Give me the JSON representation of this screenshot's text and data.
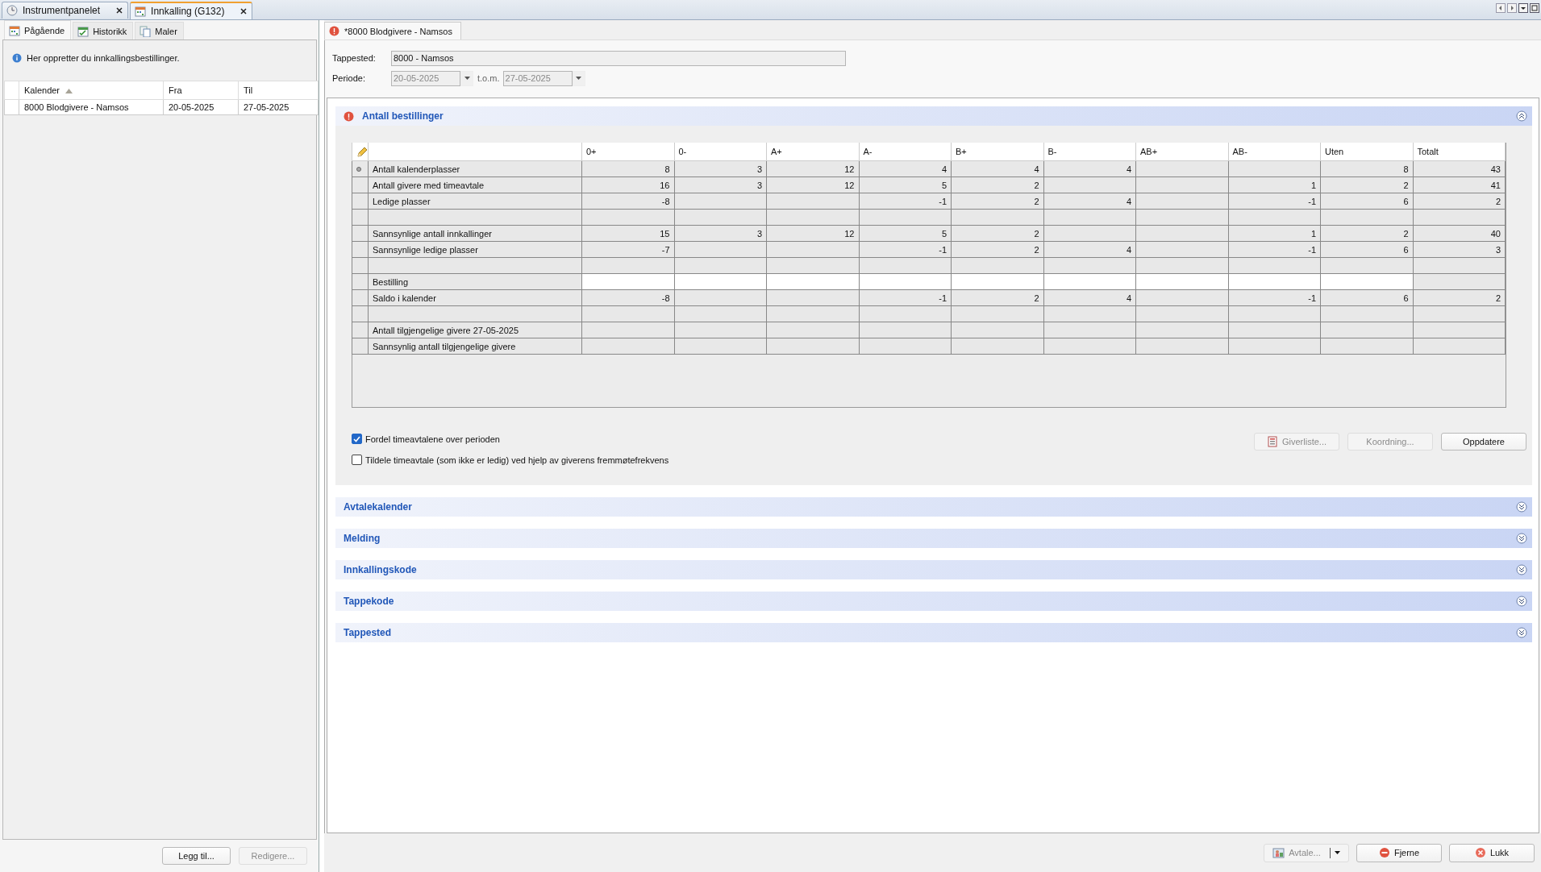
{
  "app_tabs": [
    {
      "label": "Instrumentpanelet",
      "selected": false
    },
    {
      "label": "Innkalling (G132)",
      "selected": true
    }
  ],
  "left_panel": {
    "tabs": [
      {
        "label": "Pågående",
        "selected": true
      },
      {
        "label": "Historikk",
        "selected": false
      },
      {
        "label": "Maler",
        "selected": false
      }
    ],
    "info": "Her oppretter du innkallingsbestillinger.",
    "table": {
      "columns": [
        {
          "label": "Kalender",
          "sorted": true
        },
        {
          "label": "Fra",
          "sorted": false
        },
        {
          "label": "Til",
          "sorted": false
        }
      ],
      "rows": [
        [
          "8000 Blodgivere - Namsos",
          "20-05-2025",
          "27-05-2025"
        ]
      ]
    },
    "buttons": [
      {
        "label": "Legg til...",
        "disabled": false
      },
      {
        "label": "Redigere...",
        "disabled": true
      }
    ]
  },
  "document": {
    "tab": {
      "label": "*8000 Blodgivere - Namsos",
      "error": true
    },
    "form": {
      "tappested_label": "Tappested:",
      "tappested_value": "8000 - Namsos",
      "periode_label": "Periode:",
      "from": "20-05-2025",
      "separator": "t.o.m.",
      "to": "27-05-2025"
    },
    "sections": [
      {
        "title": "Antall bestillinger",
        "expanded": true,
        "error": true,
        "grid": {
          "columns": [
            "0+",
            "0-",
            "A+",
            "A-",
            "B+",
            "B-",
            "AB+",
            "AB-",
            "Uten",
            "Totalt"
          ],
          "rows": [
            {
              "kind": "data",
              "current": true,
              "label": "Antall kalenderplasser",
              "cells": [
                "8",
                "3",
                "12",
                "4",
                "4",
                "4",
                null,
                null,
                "8",
                "43"
              ]
            },
            {
              "kind": "data",
              "current": false,
              "label": "Antall givere med timeavtale",
              "cells": [
                "16",
                "3",
                "12",
                "5",
                "2",
                null,
                null,
                "1",
                "2",
                "41"
              ]
            },
            {
              "kind": "data",
              "current": false,
              "label": "Ledige plasser",
              "cells": [
                "-8",
                null,
                null,
                "-1",
                "2",
                "4",
                null,
                "-1",
                "6",
                "2"
              ]
            },
            {
              "kind": "blank",
              "current": false
            },
            {
              "kind": "data",
              "current": false,
              "label": "Sannsynlige antall innkallinger",
              "cells": [
                "15",
                "3",
                "12",
                "5",
                "2",
                null,
                null,
                "1",
                "2",
                "40"
              ]
            },
            {
              "kind": "data",
              "current": false,
              "label": "Sannsynlige ledige plasser",
              "cells": [
                "-7",
                null,
                null,
                "-1",
                "2",
                "4",
                null,
                "-1",
                "6",
                "3"
              ]
            },
            {
              "kind": "blank",
              "current": false
            },
            {
              "kind": "input",
              "current": false,
              "label": "Bestilling"
            },
            {
              "kind": "data",
              "current": false,
              "label": "Saldo i kalender",
              "cells": [
                "-8",
                null,
                null,
                "-1",
                "2",
                "4",
                null,
                "-1",
                "6",
                "2"
              ]
            },
            {
              "kind": "blank",
              "current": false
            },
            {
              "kind": "data",
              "current": false,
              "label": "Antall tilgjengelige givere 27-05-2025"
            },
            {
              "kind": "data",
              "current": false,
              "label": "Sannsynlig antall tilgjengelige givere"
            }
          ]
        },
        "checkboxes": [
          {
            "label": "Fordel timeavtalene over perioden",
            "checked": true
          },
          {
            "label": "Tildele timeavtale (som ikke er ledig) ved hjelp av giverens fremmøtefrekvens",
            "checked": false
          }
        ],
        "buttons": [
          {
            "label": "Giverliste...",
            "kind": "list",
            "disabled": true
          },
          {
            "label": "Koordning...",
            "kind": "plain",
            "disabled": true
          },
          {
            "label": "Oppdatere",
            "kind": "plain",
            "disabled": false
          }
        ]
      },
      {
        "title": "Avtalekalender",
        "expanded": false,
        "error": false
      },
      {
        "title": "Melding",
        "expanded": false,
        "error": false
      },
      {
        "title": "Innkallingskode",
        "expanded": false,
        "error": false
      },
      {
        "title": "Tappekode",
        "expanded": false,
        "error": false
      },
      {
        "title": "Tappested",
        "expanded": false,
        "error": false
      }
    ],
    "buttons": [
      {
        "label": "Avtale...",
        "kind": "split",
        "disabled": true
      },
      {
        "label": "Fjerne",
        "kind": "remove",
        "disabled": false
      },
      {
        "label": "Lukk",
        "kind": "close",
        "disabled": false
      }
    ]
  }
}
